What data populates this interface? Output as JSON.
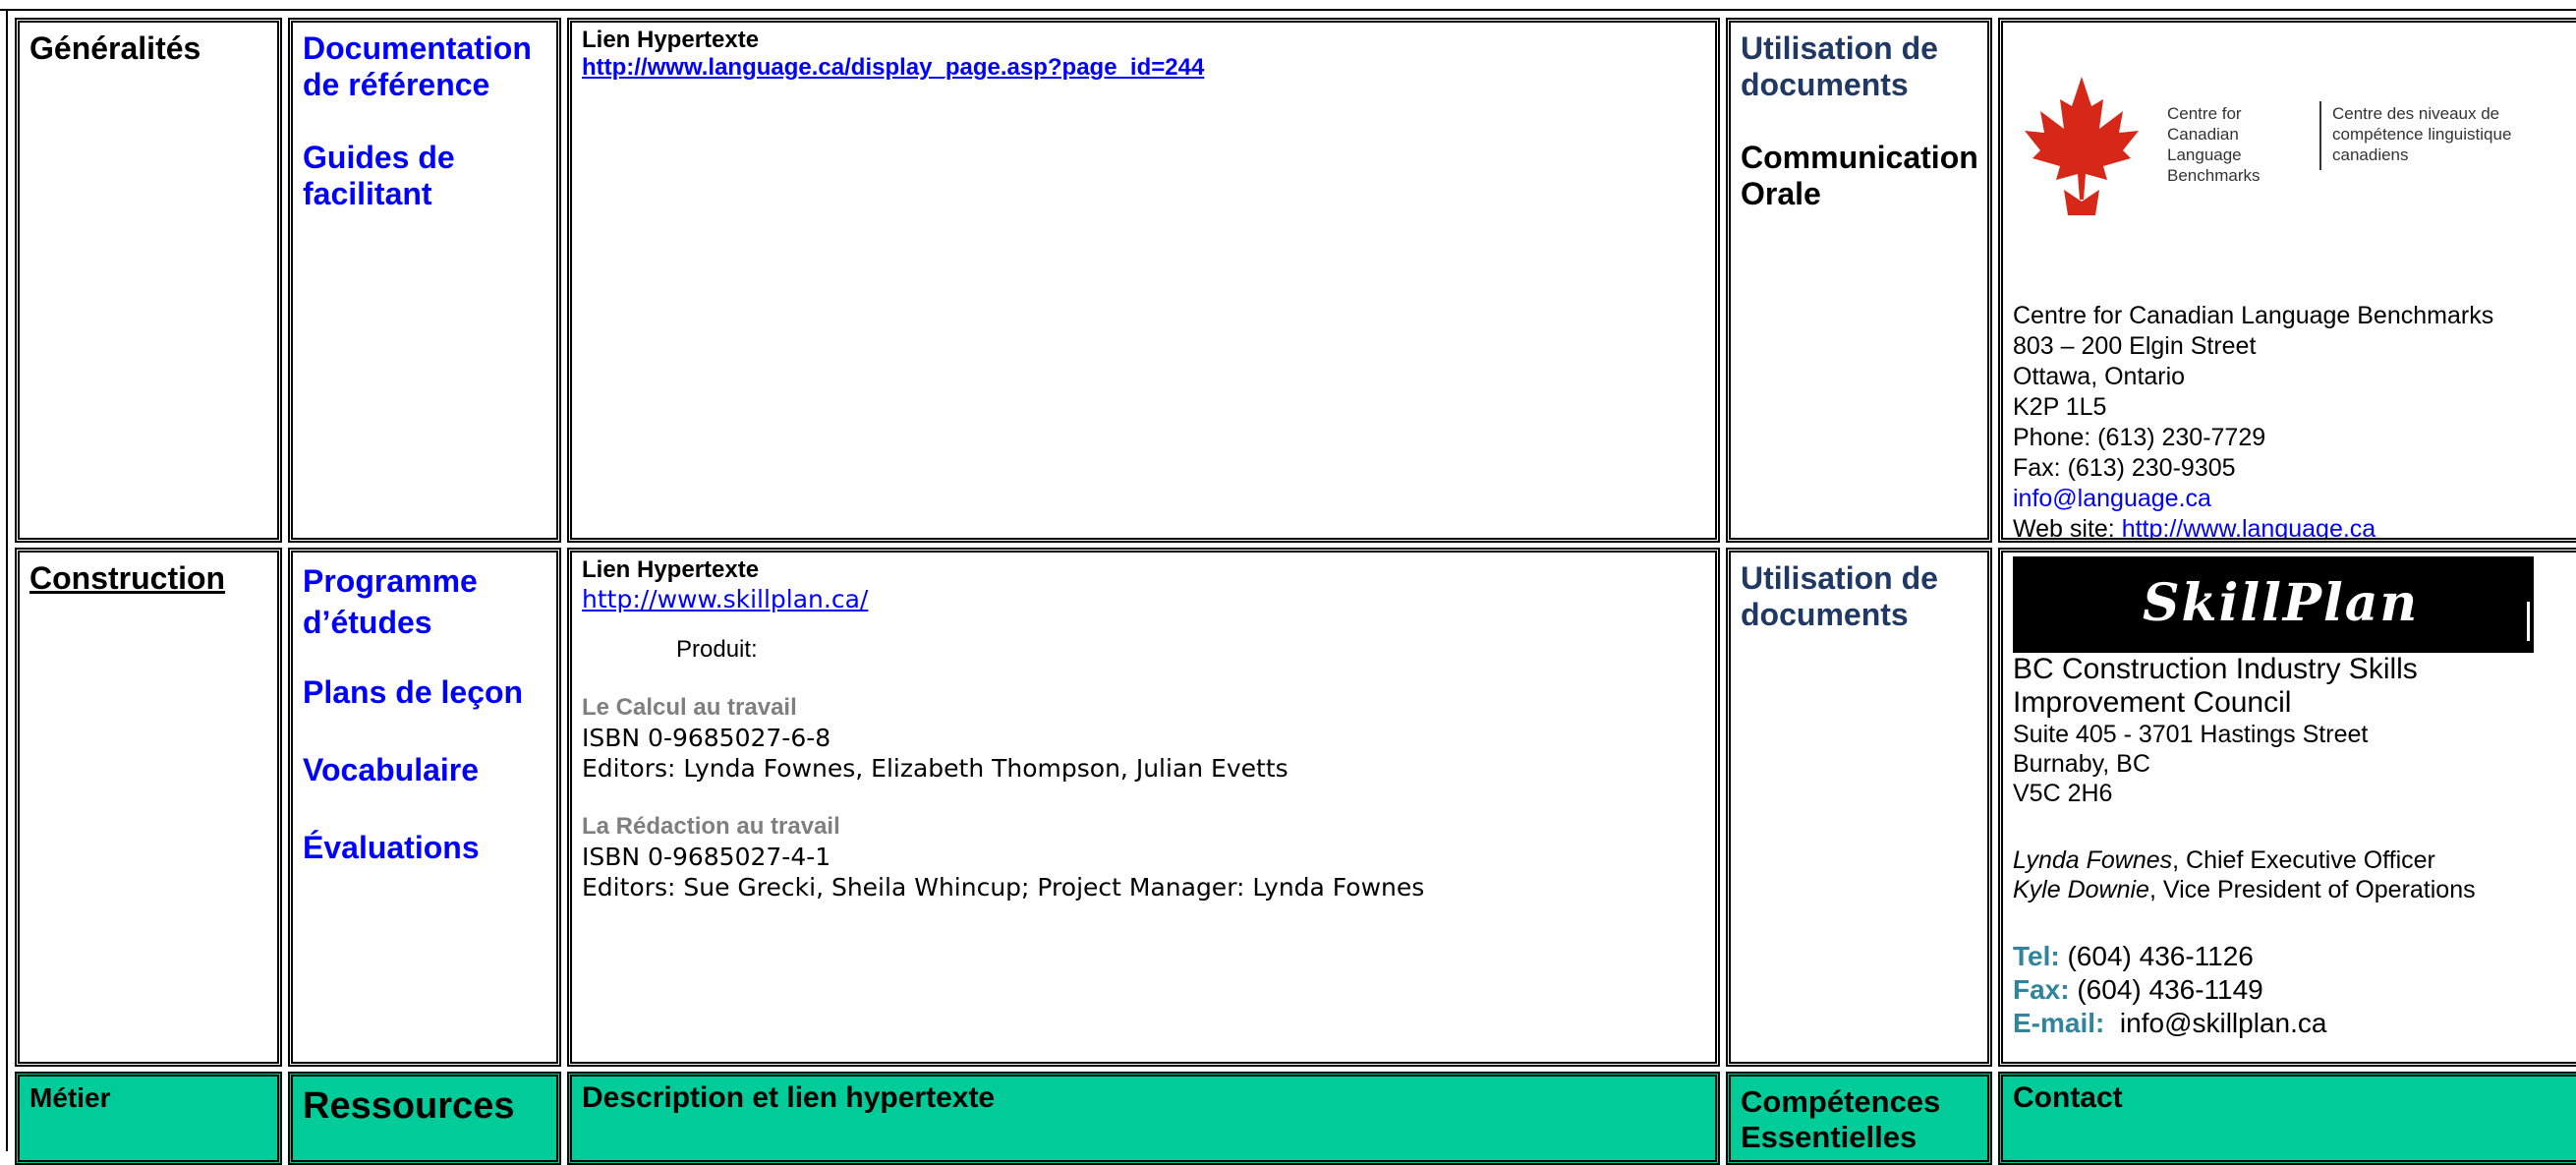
{
  "row1": {
    "trade": "Généralités",
    "resources": [
      "Documentation de référence",
      "Guides de facilitant"
    ],
    "desc_heading": "Lien Hypertexte",
    "desc_link": "http://www.language.ca/display_page.asp?page_id=244",
    "skills": [
      "Utilisation de documents",
      "Communication Orale"
    ],
    "logo": {
      "en": "Centre for Canadian Language Benchmarks",
      "fr": "Centre des niveaux de compétence linguistique canadiens"
    },
    "contact_lines": [
      "Centre for Canadian Language Benchmarks",
      "803 – 200 Elgin Street",
      "Ottawa, Ontario",
      "K2P 1L5",
      "Phone: (613) 230-7729",
      "Fax: (613) 230-9305"
    ],
    "email": "info@language.ca",
    "web_label": "Web site: ",
    "web_link": "http://www.language.ca"
  },
  "row2": {
    "trade": "Construction",
    "resources": [
      "Programme d’études",
      "Plans de leçon",
      "Vocabulaire",
      "Évaluations"
    ],
    "desc_heading": "Lien Hypertexte",
    "desc_link": "http://www.skillplan.ca/",
    "product_label": "Produit:",
    "products": [
      {
        "title": "Le Calcul au travail",
        "isbn": "ISBN 0-9685027-6-8",
        "editors": "Editors: Lynda Fownes, Elizabeth Thompson, Julian Evetts"
      },
      {
        "title": "La Rédaction au travail",
        "isbn": "ISBN 0-9685027-4-1",
        "editors": "Editors: Sue Grecki, Sheila Whincup; Project Manager: Lynda Fownes"
      }
    ],
    "skills": [
      "Utilisation de documents"
    ],
    "logo_text": "SkillPlan",
    "org_name": "BC Construction Industry Skills Improvement Council",
    "address_lines": [
      "Suite 405 - 3701 Hastings Street",
      "Burnaby, BC",
      "V5C 2H6"
    ],
    "people": [
      {
        "name": "Lynda Fownes",
        "role": ", Chief Executive Officer"
      },
      {
        "name": "Kyle Downie",
        "role": ", Vice President of Operations"
      }
    ],
    "tel_label": "Tel:",
    "tel": " (604) 436-1126",
    "fax_label": "Fax:",
    "fax": " (604) 436-1149",
    "email_label": "E-mail:",
    "email": "  info@skillplan.ca"
  },
  "header": {
    "trade": "Métier",
    "resources": "Ressources",
    "description": "Description et lien hypertexte",
    "skills": "Compétences Essentielles",
    "contact": "Contact"
  },
  "colors": {
    "header_green": "#00cc99",
    "link_blue": "#0000ff",
    "navy": "#1f3864",
    "teal": "#31849b"
  }
}
